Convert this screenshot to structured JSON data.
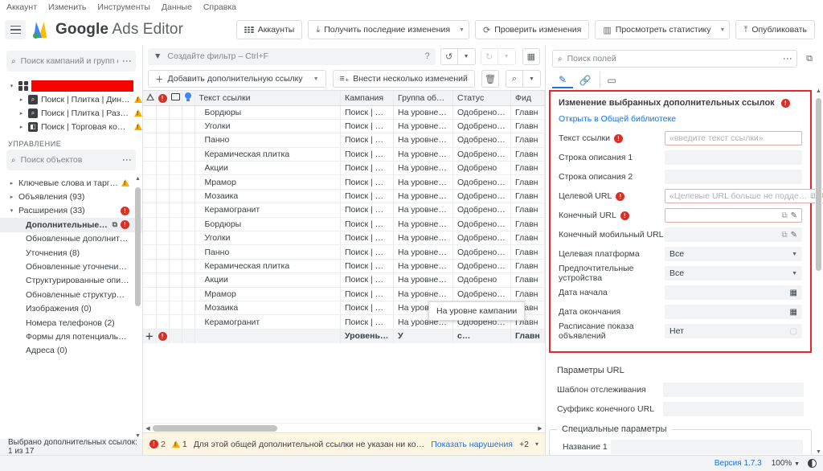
{
  "menubar": {
    "items": [
      "Аккаунт",
      "Изменить",
      "Инструменты",
      "Данные",
      "Справка"
    ]
  },
  "header": {
    "brand_bold": "Google",
    "brand_light": " Ads Editor",
    "buttons": [
      {
        "label": "Аккаунты",
        "icon": "grid-icon",
        "split": false
      },
      {
        "label": "Получить последние изменения",
        "icon": "download-icon",
        "split": true
      },
      {
        "label": "Проверить изменения",
        "icon": "refresh-icon",
        "split": false
      },
      {
        "label": "Просмотреть статистику",
        "icon": "bar-chart-icon",
        "split": true
      },
      {
        "label": "Опубликовать",
        "icon": "upload-icon",
        "split": false
      }
    ]
  },
  "sidebar": {
    "campaign_search_placeholder": "Поиск кампаний и групп о…",
    "tree": [
      {
        "label": "",
        "redacted": true,
        "expanded": true,
        "level": 0,
        "icon": "grid-icon",
        "warn": false
      },
      {
        "label": "Поиск | Плитка | Динам…",
        "redacted": false,
        "expanded": false,
        "level": 1,
        "icon": "search-campaign-icon",
        "warn": true
      },
      {
        "label": "Поиск | Плитка | Размер…",
        "redacted": false,
        "expanded": false,
        "level": 1,
        "icon": "search-campaign-icon",
        "warn": true
      },
      {
        "label": "Поиск | Торговая компа…",
        "redacted": false,
        "expanded": false,
        "level": 1,
        "icon": "shopping-campaign-icon",
        "warn": true
      }
    ],
    "section_title": "УПРАВЛЕНИЕ",
    "object_search_placeholder": "Поиск объектов",
    "objects": [
      {
        "label": "Ключевые слова и таргетин…",
        "level": 0,
        "arrow": "▸",
        "warn": true,
        "error": false,
        "selected": false,
        "edit": false
      },
      {
        "label": "Объявления (93)",
        "level": 0,
        "arrow": "▸",
        "warn": false,
        "error": false,
        "selected": false,
        "edit": false
      },
      {
        "label": "Расширения (33)",
        "level": 0,
        "arrow": "▾",
        "warn": false,
        "error": true,
        "selected": false,
        "edit": false
      },
      {
        "label": "Дополнительные ссы…",
        "level": 1,
        "arrow": "",
        "warn": false,
        "error": true,
        "selected": true,
        "edit": true
      },
      {
        "label": "Обновленные дополнительн…",
        "level": 1,
        "arrow": "",
        "warn": false,
        "error": false,
        "selected": false,
        "edit": false
      },
      {
        "label": "Уточнения (8)",
        "level": 1,
        "arrow": "",
        "warn": false,
        "error": false,
        "selected": false,
        "edit": false
      },
      {
        "label": "Обновленные уточнения (0)",
        "level": 1,
        "arrow": "",
        "warn": false,
        "error": false,
        "selected": false,
        "edit": false
      },
      {
        "label": "Структурированные описани…",
        "level": 1,
        "arrow": "",
        "warn": false,
        "error": false,
        "selected": false,
        "edit": false
      },
      {
        "label": "Обновленные структурирова…",
        "level": 1,
        "arrow": "",
        "warn": false,
        "error": false,
        "selected": false,
        "edit": false
      },
      {
        "label": "Изображения (0)",
        "level": 1,
        "arrow": "",
        "warn": false,
        "error": false,
        "selected": false,
        "edit": false
      },
      {
        "label": "Номера телефонов (2)",
        "level": 1,
        "arrow": "",
        "warn": false,
        "error": false,
        "selected": false,
        "edit": false
      },
      {
        "label": "Формы для потенциальных к…",
        "level": 1,
        "arrow": "",
        "warn": false,
        "error": false,
        "selected": false,
        "edit": false
      },
      {
        "label": "Адреса (0)",
        "level": 1,
        "arrow": "",
        "warn": false,
        "error": false,
        "selected": false,
        "edit": false
      }
    ],
    "footer_status": "Выбрано дополнительных ссылок: 1 из 17"
  },
  "center": {
    "filter_placeholder": "Создайте фильтр – Ctrl+F",
    "toolbar": {
      "add_label": "Добавить дополнительную ссылку",
      "bulk_label": "Внести несколько изменений",
      "undo_icon": "undo-icon",
      "redo_icon": "redo-icon",
      "columns_icon": "columns-icon",
      "delete_icon": "trash-icon",
      "find_replace_icon": "find-replace-icon",
      "help_icon": "help-icon"
    },
    "table": {
      "columns": [
        "Текст ссылки",
        "Кампания",
        "Группа объявл…",
        "Статус",
        "Фид"
      ],
      "icon_columns": [
        "change-status-icon",
        "error-icon",
        "comment-icon",
        "idea-icon"
      ],
      "rows": [
        {
          "text": "Бордюры",
          "campaign": "Поиск | Плитк…",
          "group": "На уровне ка…",
          "status": "Одобрено (с о…",
          "feed": "Главн"
        },
        {
          "text": "Уголки",
          "campaign": "Поиск | Плитк…",
          "group": "На уровне ка…",
          "status": "Одобрено (с о…",
          "feed": "Главн"
        },
        {
          "text": "Панно",
          "campaign": "Поиск | Плитк…",
          "group": "На уровне ка…",
          "status": "Одобрено (с о…",
          "feed": "Главн"
        },
        {
          "text": "Керамическая плитка",
          "campaign": "Поиск | Плитк…",
          "group": "На уровне ка…",
          "status": "Одобрено (с о…",
          "feed": "Главн"
        },
        {
          "text": "Акции",
          "campaign": "Поиск | Плитк…",
          "group": "На уровне ка…",
          "status": "Одобрено",
          "feed": "Главн"
        },
        {
          "text": "Мрамор",
          "campaign": "Поиск | Плитк…",
          "group": "На уровне ка…",
          "status": "Одобрено (с о…",
          "feed": "Главн"
        },
        {
          "text": "Мозаика",
          "campaign": "Поиск | Плитк…",
          "group": "На уровне ка…",
          "status": "Одобрено (с о…",
          "feed": "Главн"
        },
        {
          "text": "Керамогранит",
          "campaign": "Поиск | Плитк…",
          "group": "На уровне ка…",
          "status": "Одобрено (с о…",
          "feed": "Главн"
        },
        {
          "text": "Бордюры",
          "campaign": "Поиск | Плитк…",
          "group": "На уровне ка…",
          "status": "Одобрено (с о…",
          "feed": "Главн"
        },
        {
          "text": "Уголки",
          "campaign": "Поиск | Плитк…",
          "group": "На уровне ка…",
          "status": "Одобрено (с о…",
          "feed": "Главн"
        },
        {
          "text": "Панно",
          "campaign": "Поиск | Плитк…",
          "group": "На уровне ка…",
          "status": "Одобрено (с о…",
          "feed": "Главн"
        },
        {
          "text": "Керамическая плитка",
          "campaign": "Поиск | Плитк…",
          "group": "На уровне ка…",
          "status": "Одобрено (с о…",
          "feed": "Главн"
        },
        {
          "text": "Акции",
          "campaign": "Поиск | Плитк…",
          "group": "На уровне ка…",
          "status": "Одобрено",
          "feed": "Главн"
        },
        {
          "text": "Мрамор",
          "campaign": "Поиск | Плитк…",
          "group": "На уровне ка…",
          "status": "Одобрено (с о…",
          "feed": "Главн"
        },
        {
          "text": "Мозаика",
          "campaign": "Поиск | Плитк…",
          "group": "На уровне ка…",
          "status": "Одобрено (с о…",
          "feed": "Главн"
        },
        {
          "text": "Керамогранит",
          "campaign": "Поиск | Плитк…",
          "group": "На уровне ка…",
          "status": "Одобрено (с о…",
          "feed": "Главн"
        }
      ],
      "add_row": {
        "campaign": "Уровень акка…",
        "group": "У",
        "status": "с…",
        "feed": "Главн"
      }
    },
    "tooltip": "На уровне кампании",
    "error_bar": {
      "error_count": "2",
      "warning_count": "1",
      "message": "Для этой общей дополнительной ссылки не указан ни конечный, ни …",
      "action_label": "Показать нарушения",
      "more": "+2"
    }
  },
  "right_panel": {
    "search_placeholder": "Поиск полей",
    "tabs": [
      {
        "icon": "pencil-icon",
        "active": true
      },
      {
        "icon": "link-icon",
        "active": false
      },
      {
        "icon": "comment-icon",
        "active": false
      }
    ],
    "title": "Изменение выбранных дополнительных ссылок",
    "shared_library_link": "Открыть в Общей библиотеке",
    "fields": [
      {
        "label": "Текст ссылки",
        "error": true,
        "value": "",
        "placeholder": "«введите текст ссылки»",
        "type": "text",
        "highlight": true
      },
      {
        "label": "Строка описания 1",
        "error": false,
        "value": "",
        "placeholder": "",
        "type": "text",
        "highlight": false
      },
      {
        "label": "Строка описания 2",
        "error": false,
        "value": "",
        "placeholder": "",
        "type": "text",
        "highlight": false
      },
      {
        "label": "Целевой URL",
        "error": true,
        "value": "",
        "placeholder": "«Целевые URL больше не подде…",
        "type": "url",
        "highlight": true
      },
      {
        "label": "Конечный URL",
        "error": true,
        "value": "",
        "placeholder": "",
        "type": "url",
        "highlight": true
      },
      {
        "label": "Конечный мобильный URL",
        "error": false,
        "value": "",
        "placeholder": "",
        "type": "url",
        "highlight": false
      },
      {
        "label": "Целевая платформа",
        "error": false,
        "value": "Все",
        "placeholder": "",
        "type": "select",
        "highlight": false
      },
      {
        "label": "Предпочтительные устройства",
        "error": false,
        "value": "Все",
        "placeholder": "",
        "type": "select",
        "highlight": false
      },
      {
        "label": "Дата начала",
        "error": false,
        "value": "",
        "placeholder": "",
        "type": "date",
        "highlight": false
      },
      {
        "label": "Дата окончания",
        "error": false,
        "value": "",
        "placeholder": "",
        "type": "date",
        "highlight": false
      },
      {
        "label": "Расписание показа объявлений",
        "error": false,
        "value": "Нет",
        "placeholder": "",
        "type": "schedule",
        "highlight": false
      }
    ],
    "url_params": {
      "title": "Параметры URL",
      "fields": [
        {
          "label": "Шаблон отслеживания",
          "value": ""
        },
        {
          "label": "Суффикс конечного URL",
          "value": ""
        }
      ]
    },
    "custom_params": {
      "legend": "Специальные параметры",
      "fields": [
        {
          "label": "Название 1",
          "value": ""
        }
      ]
    }
  },
  "statusbar": {
    "version": "Версия 1.7.3",
    "zoom": "100%",
    "contrast_icon": "contrast-icon"
  }
}
